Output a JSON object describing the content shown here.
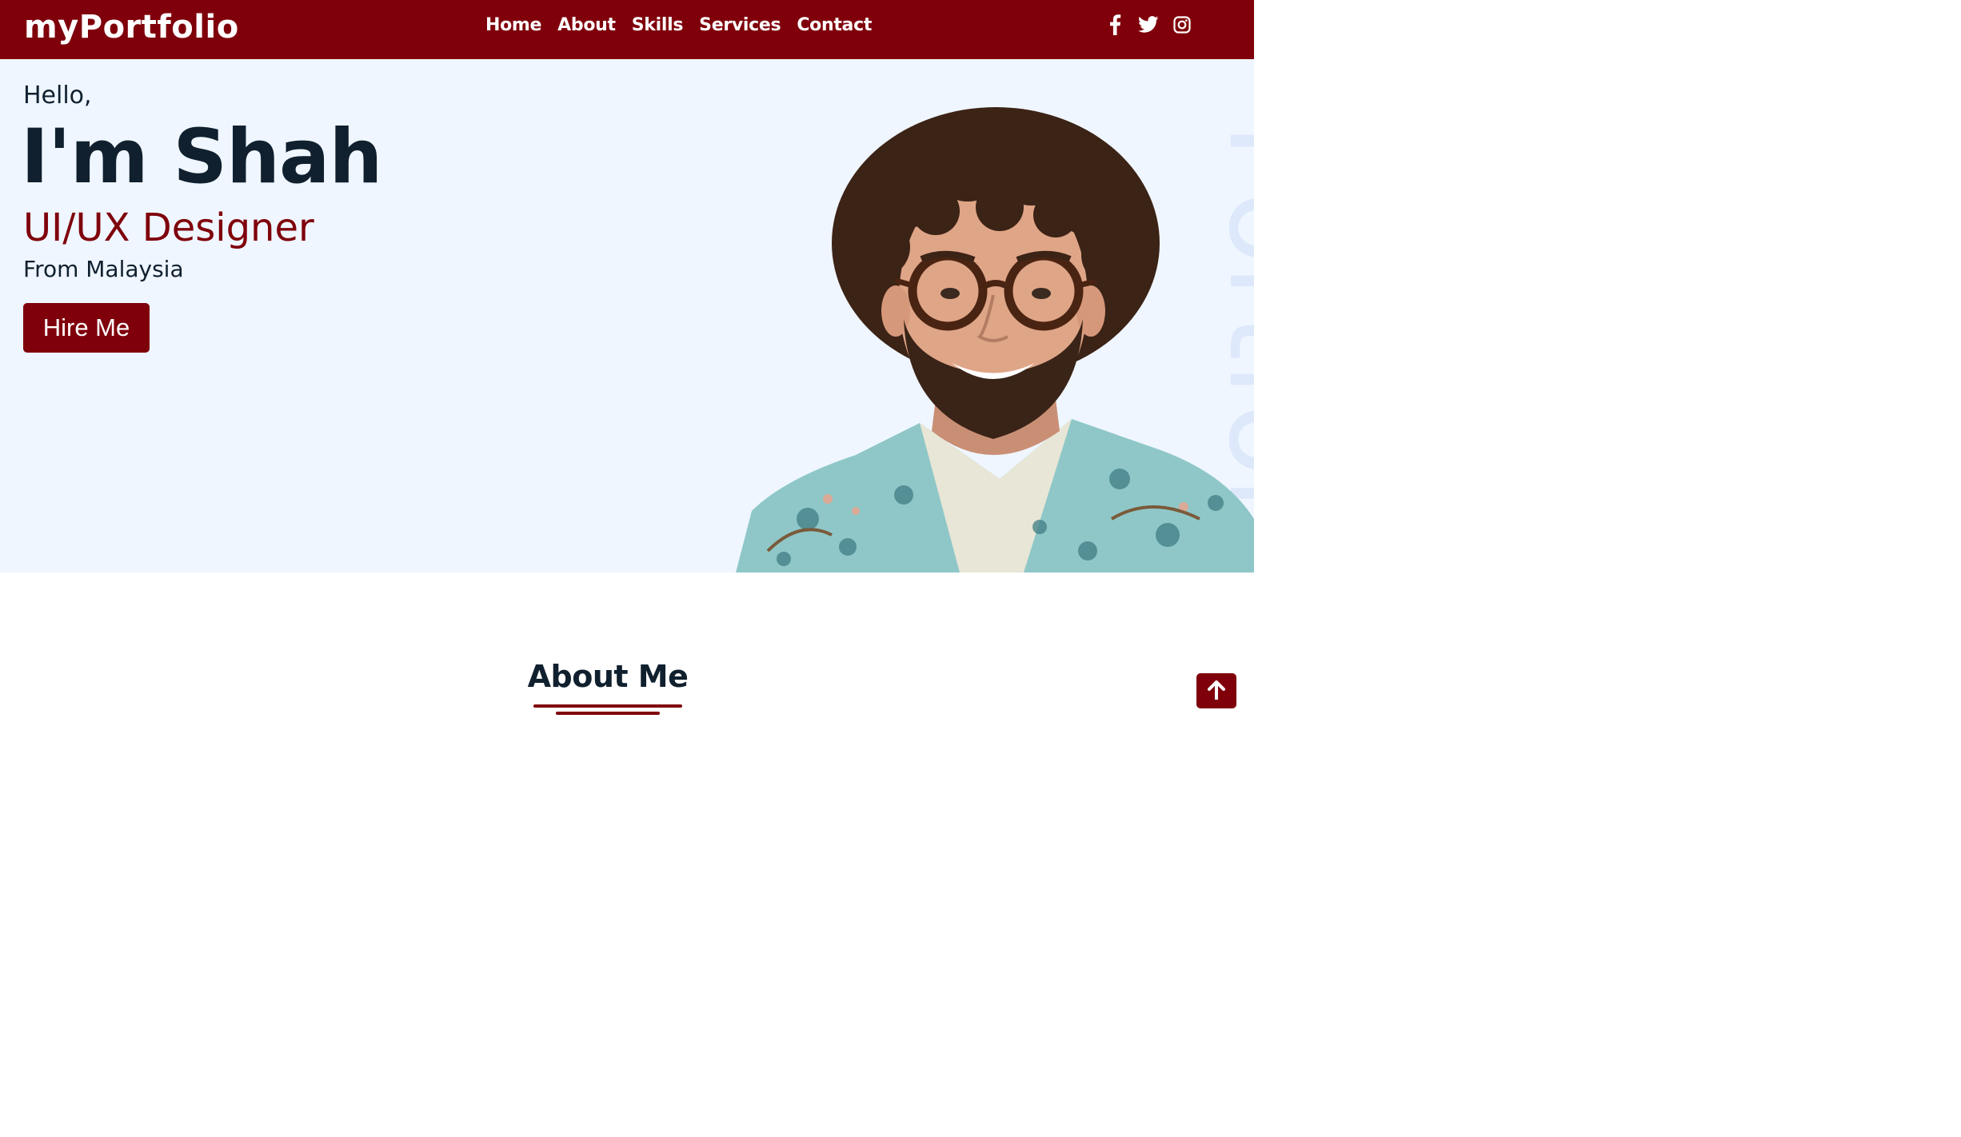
{
  "brand": "myPortfolio",
  "nav": {
    "links": [
      "Home",
      "About",
      "Skills",
      "Services",
      "Contact"
    ]
  },
  "socials": {
    "icons": [
      "facebook-icon",
      "twitter-icon",
      "instagram-icon"
    ]
  },
  "hero": {
    "greeting": "Hello,",
    "name": "I'm Shah",
    "role": "UI/UX Designer",
    "origin": "From Malaysia",
    "cta_label": "Hire Me",
    "watermark": "Portfolio"
  },
  "about": {
    "title": "About Me"
  },
  "scroll_top": {
    "icon": "arrow-up-icon"
  },
  "colors": {
    "brand": "#7f000b",
    "hero_bg": "#eff6ff",
    "text_dark": "#10202e",
    "watermark": "#dde8fb"
  }
}
